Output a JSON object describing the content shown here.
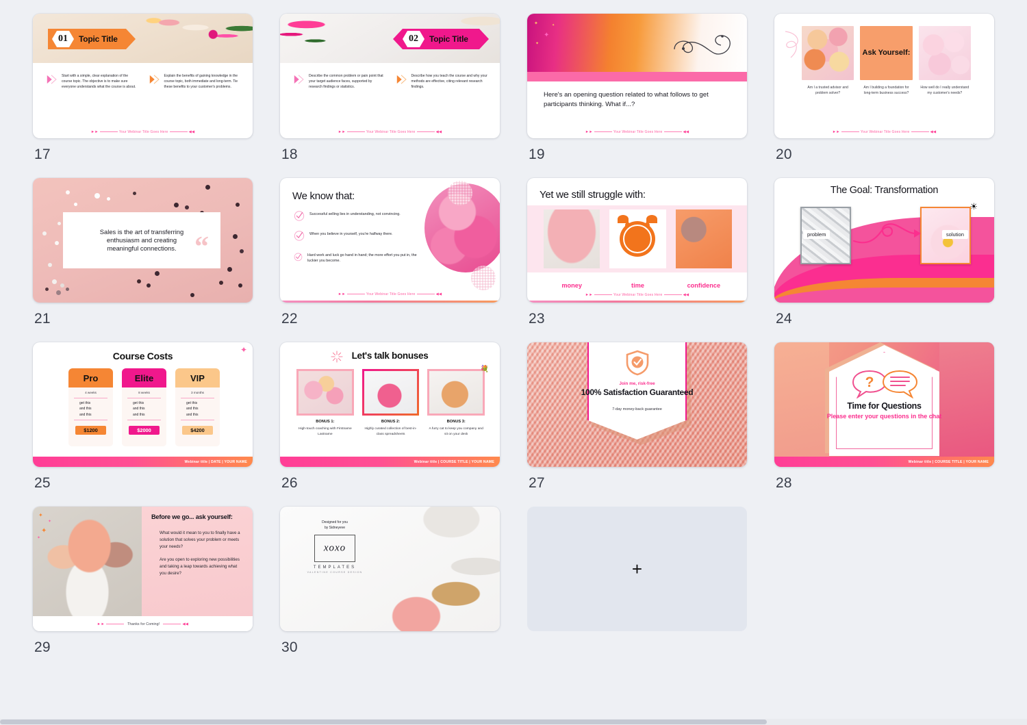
{
  "app": {
    "background": "#eef0f4",
    "accent_pink": "#fb2f8e",
    "accent_orange": "#f58634"
  },
  "scrollbar": {
    "present": true
  },
  "slides": [
    {
      "number": "17",
      "kind": "topic-title",
      "badge_number": "01",
      "badge_color": "#f58634",
      "title": "Topic Title",
      "columns": [
        {
          "chevron_color": "#f472b6",
          "text": "Start with a simple, clear explanation of the course topic. The objective is to make sure everyone understands what the course is about."
        },
        {
          "chevron_color": "#f58634",
          "text": "Explain the benefits of gaining knowledge in the course topic, both immediate and long-term. Tie these benefits to your customer's problems."
        }
      ],
      "footer": "Your Webinar Title Goes Here"
    },
    {
      "number": "18",
      "kind": "topic-title",
      "badge_number": "02",
      "badge_color": "#f0188c",
      "title": "Topic Title",
      "columns": [
        {
          "chevron_color": "#f472b6",
          "text": "Describe the common problem or pain point that your target audience faces, supported by research findings or statistics."
        },
        {
          "chevron_color": "#f58634",
          "text": "Describe how you teach the course and why your methods are effective, citing relevant research findings."
        }
      ],
      "footer": "Your Webinar Title Goes Here"
    },
    {
      "number": "19",
      "kind": "opening-question",
      "question": "Here's an opening question related to what follows to get participants thinking. What if...?",
      "footer": "Your Webinar Title Goes Here"
    },
    {
      "number": "20",
      "kind": "ask-yourself",
      "center_title": "Ask Yourself:",
      "captions": [
        "Am I a trusted advisor and problem solver?",
        "Am I building a foundation for long-term business success?",
        "How well do I really understand my customer's needs?"
      ],
      "footer": "Your Webinar Title Goes Here"
    },
    {
      "number": "21",
      "kind": "quote",
      "quote": "Sales is the art of transferring enthusiasm and creating meaningful connections.",
      "open_quote_glyph": "“",
      "close_quote_glyph": "”"
    },
    {
      "number": "22",
      "kind": "checklist",
      "heading": "We know that:",
      "items": [
        "Successful selling lies in understanding, not convincing.",
        "When you believe in yourself, you're halfway there.",
        "Hard work and luck go hand in hand; the more effort you put in, the luckier you become."
      ],
      "footer": "Your Webinar Title Goes Here"
    },
    {
      "number": "23",
      "kind": "struggle",
      "heading": "Yet we still struggle with:",
      "labels": [
        "money",
        "time",
        "confidence"
      ],
      "footer": "Your Webinar Title Goes Here"
    },
    {
      "number": "24",
      "kind": "transformation",
      "heading": "The Goal: Transformation",
      "left_label": "problem",
      "right_label": "solution"
    },
    {
      "number": "25",
      "kind": "pricing",
      "heading": "Course Costs",
      "plans": [
        {
          "name": "Pro",
          "color": "#f58634",
          "duration": "4 weeks",
          "features": [
            "get this",
            "and this",
            "and this"
          ],
          "price": "$1200"
        },
        {
          "name": "Elite",
          "color": "#f0188c",
          "duration": "8 weeks",
          "features": [
            "get this",
            "and this",
            "and this"
          ],
          "price": "$2000"
        },
        {
          "name": "VIP",
          "color": "#fbc78a",
          "duration": "3 months",
          "features": [
            "get this",
            "and this",
            "and this"
          ],
          "price": "$4200"
        }
      ],
      "footer_bar": "Webinar title | DATE | YOUR NAME"
    },
    {
      "number": "26",
      "kind": "bonuses",
      "heading": "Let's talk bonuses",
      "bonuses": [
        {
          "label": "BONUS 1:",
          "text": "High-touch coaching with Firstname Lastname"
        },
        {
          "label": "BONUS 2:",
          "text": "Highly curated collection of best-in-class spreadsheets"
        },
        {
          "label": "BONUS 3:",
          "text": "A furry cat to keep you company and sit on your desk"
        }
      ],
      "footer_bar": "Webinar title | COURSE TITLE | YOUR NAME"
    },
    {
      "number": "27",
      "kind": "guarantee",
      "eyebrow": "Join me, risk-free",
      "headline": "100% Satisfaction Guaranteed",
      "subtext": "7-day money-back guarantee"
    },
    {
      "number": "28",
      "kind": "questions",
      "title": "Time for Questions",
      "subtitle": "Please enter your questions in the chat",
      "question_glyph": "?",
      "footer_bar": "Webinar title | COURSE TITLE | YOUR NAME"
    },
    {
      "number": "29",
      "kind": "closing",
      "heading": "Before we go... ask yourself:",
      "paragraphs": [
        "What would it mean to you to finally have a solution that solves your problem or meets your needs?",
        "Are you open to exploring new possibilities and taking a leap towards achieving what you desire?"
      ],
      "footer": "Thanks for Coming!"
    },
    {
      "number": "30",
      "kind": "credits",
      "designed_line1": "Designed for you",
      "designed_line2": "by Sidneyeve",
      "logo_text": "xoxo",
      "templates_word": "TEMPLATES",
      "templates_sub": "VALENTINE COURSE DESIGN"
    },
    {
      "number": "",
      "kind": "add-slide",
      "plus_glyph": "+"
    }
  ]
}
